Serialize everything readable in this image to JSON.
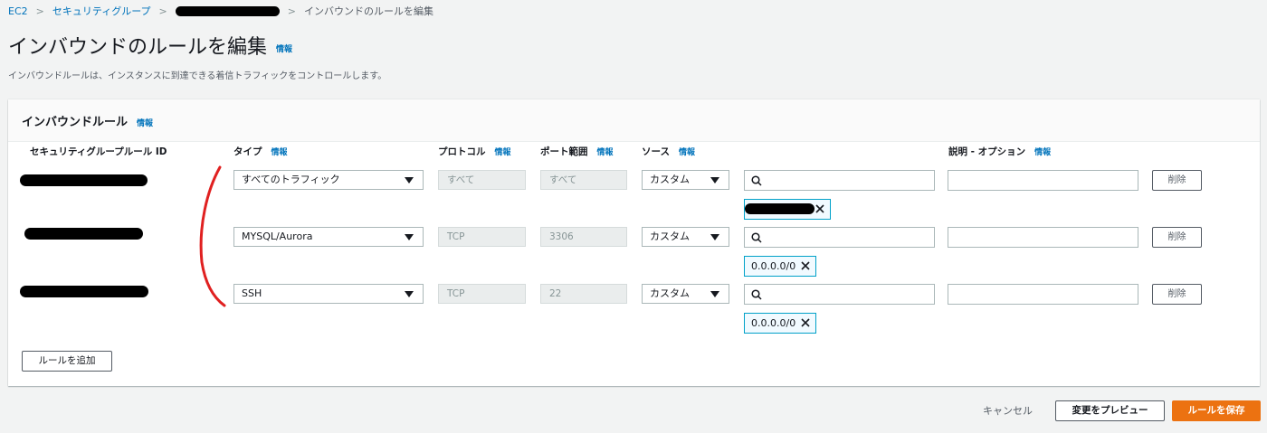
{
  "breadcrumb": {
    "items": [
      "EC2",
      "セキュリティグループ"
    ],
    "current": "インバウンドのルールを編集"
  },
  "page": {
    "title": "インバウンドのルールを編集",
    "info": "情報",
    "description": "インバウンドルールは、インスタンスに到達できる着信トラフィックをコントロールします。"
  },
  "panel": {
    "title": "インバウンドルール",
    "info": "情報",
    "columns": {
      "rule_id": "セキュリティグループルール ID",
      "type": "タイプ",
      "protocol": "プロトコル",
      "port_range": "ポート範囲",
      "source": "ソース",
      "description": "説明 - オプション"
    }
  },
  "rules": [
    {
      "type": "すべてのトラフィック",
      "protocol": "すべて",
      "port": "すべて",
      "source": "カスタム",
      "cidr": "",
      "delete": "削除"
    },
    {
      "type": "MYSQL/Aurora",
      "protocol": "TCP",
      "port": "3306",
      "source": "カスタム",
      "cidr": "0.0.0.0/0",
      "delete": "削除"
    },
    {
      "type": "SSH",
      "protocol": "TCP",
      "port": "22",
      "source": "カスタム",
      "cidr": "0.0.0.0/0",
      "delete": "削除"
    }
  ],
  "actions": {
    "add_rule": "ルールを追加",
    "cancel": "キャンセル",
    "preview": "変更をプレビュー",
    "save": "ルールを保存"
  },
  "colors": {
    "link": "#0073bb",
    "primary": "#ec7211",
    "token_border": "#00a1c9",
    "annotation": "#e02020"
  }
}
